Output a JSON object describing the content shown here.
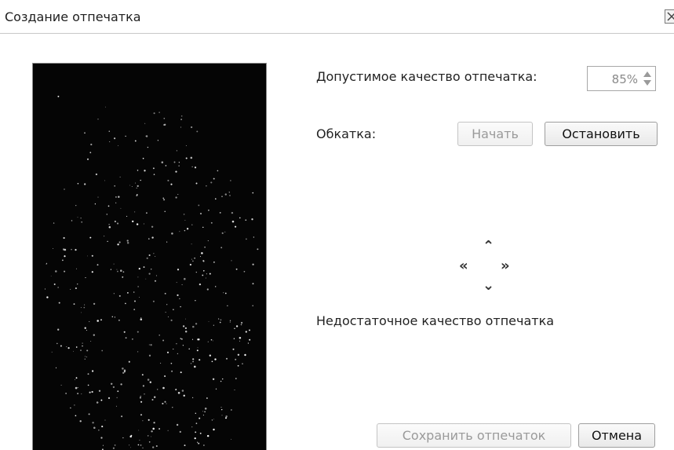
{
  "window": {
    "title": "Создание отпечатка"
  },
  "icons": {
    "close": "close-icon",
    "spin_up": "chevron-up-icon",
    "spin_down": "chevron-down-icon"
  },
  "settings": {
    "quality_label": "Допустимое качество отпечатка:",
    "quality_value": "85%",
    "rollin_label": "Обкатка:"
  },
  "buttons": {
    "start": "Начать",
    "stop": "Остановить",
    "save": "Сохранить отпечаток",
    "cancel": "Отмена"
  },
  "directions": {
    "up": "⌃",
    "left": "«",
    "right": "»",
    "down": "⌄"
  },
  "status": {
    "message": "Недостаточное качество отпечатка"
  },
  "colors": {
    "preview_background": "#050505",
    "disabled_text": "#9a9a9a"
  }
}
